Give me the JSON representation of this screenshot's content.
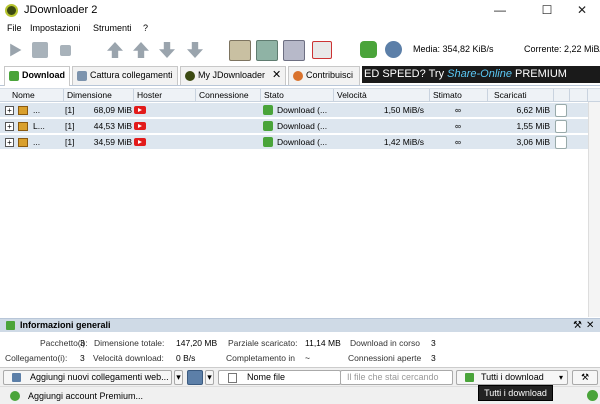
{
  "window": {
    "title": "JDownloader 2",
    "minimize": "—",
    "maximize": "☐",
    "close": "✕"
  },
  "menu": [
    "File",
    "Impostazioni",
    "Strumenti",
    "?"
  ],
  "toolbar": {
    "media_label": "Media: 354,82 KiB/s",
    "current_label": "Corrente: 2,22 MiB/s"
  },
  "tabs": [
    {
      "label": "Download"
    },
    {
      "label": "Cattura collegamenti"
    },
    {
      "label": "My JDownloader"
    },
    {
      "label": "Contribuisci"
    }
  ],
  "banner": {
    "pre": "ED SPEED? Try ",
    "brand": "Share-Online",
    "post": " PREMIUM"
  },
  "columns": [
    "Nome",
    "Dimensione",
    "Hoster",
    "Connessione",
    "Stato",
    "Velocità",
    "Stimato",
    "Scaricati"
  ],
  "rows": [
    {
      "name": "...",
      "count": "[1]",
      "size": "68,09 MiB",
      "status": "Download (...",
      "speed": "1,50 MiB/s",
      "eta": "∞",
      "downloaded": "6,62 MiB"
    },
    {
      "name": "L...",
      "count": "[1]",
      "size": "44,53 MiB",
      "status": "Download (...",
      "speed": "",
      "eta": "∞",
      "downloaded": "1,55 MiB"
    },
    {
      "name": "...",
      "count": "[1]",
      "size": "34,59 MiB",
      "status": "Download (...",
      "speed": "1,42 MiB/s",
      "eta": "∞",
      "downloaded": "3,06 MiB"
    }
  ],
  "info": {
    "title": "Informazioni generali",
    "packages_label": "Pacchetto(i):",
    "packages": "3",
    "total_size_label": "Dimensione totale:",
    "total_size": "147,20 MB",
    "partial_label": "Parziale scaricato:",
    "partial": "11,14 MB",
    "in_progress_label": "Download in corso",
    "in_progress": "3",
    "links_label": "Collegamento(i):",
    "links": "3",
    "speed_label": "Velocità download:",
    "speed": "0 B/s",
    "completion_label": "Completamento in",
    "completion": "~",
    "connections_label": "Connessioni aperte",
    "connections": "3"
  },
  "bottom": {
    "add_links": "Aggiungi nuovi collegamenti web...",
    "filename": "Nome file",
    "search_placeholder": "Il file che stai cercando",
    "all_downloads": "Tutti i download"
  },
  "status": {
    "add_premium": "Aggiungi account Premium...",
    "tooltip": "Tutti i download"
  }
}
